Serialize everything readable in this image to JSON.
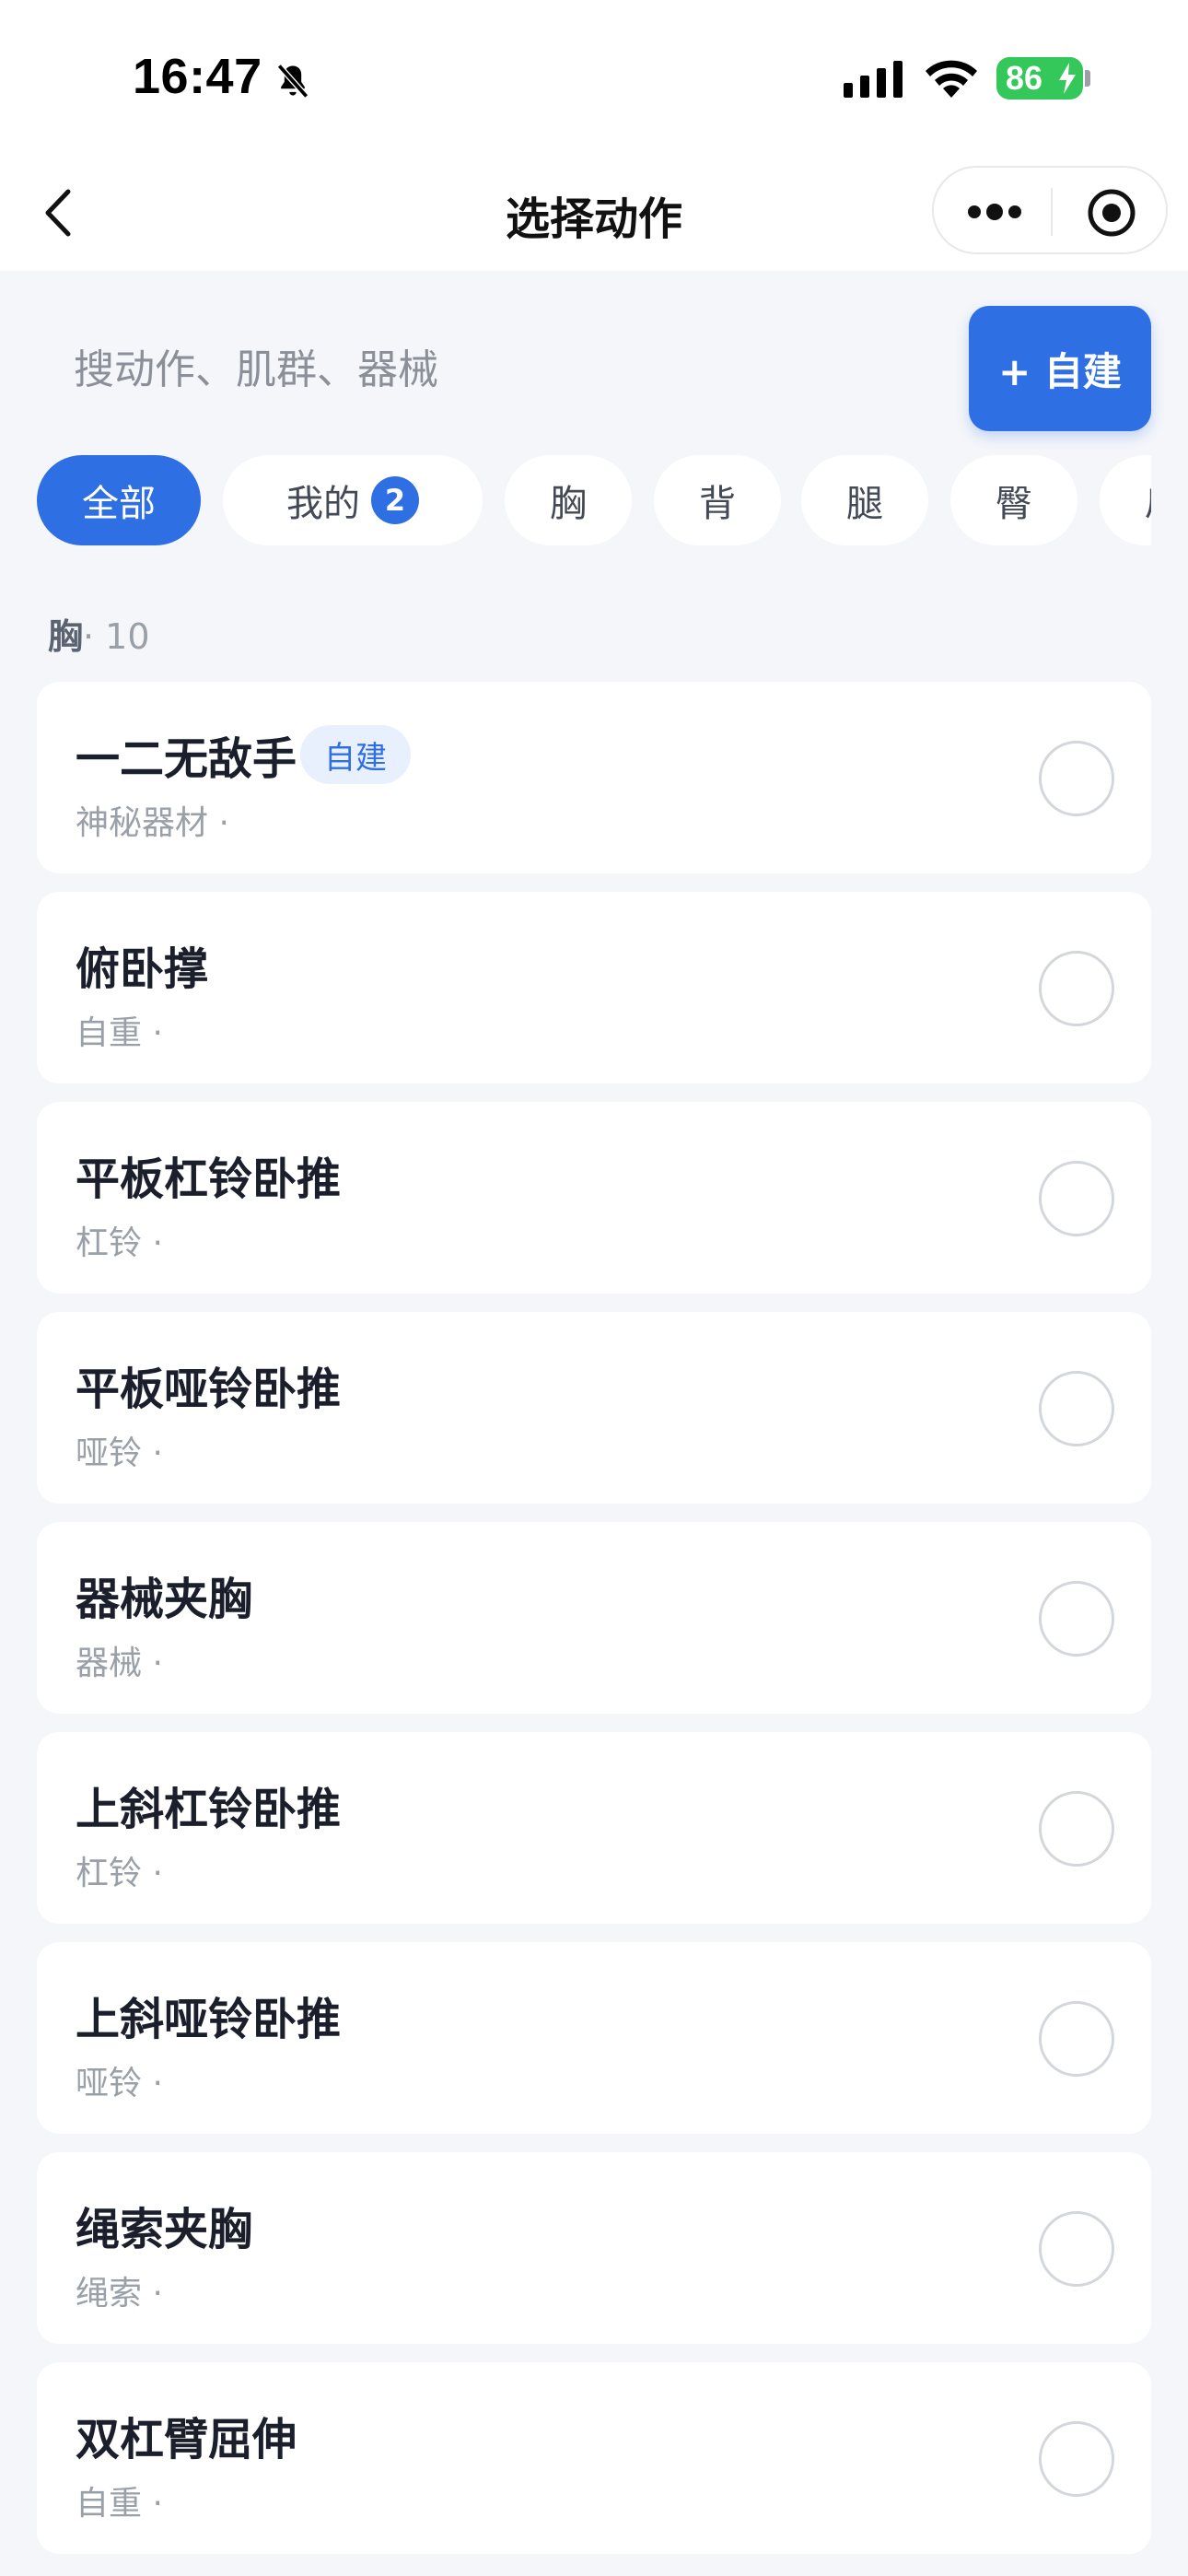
{
  "status_bar": {
    "time": "16:47",
    "battery": "86",
    "icons": [
      "bell-slash-icon",
      "cellular-signal-icon",
      "wifi-icon",
      "battery-charging-icon"
    ]
  },
  "nav": {
    "title": "选择动作",
    "icons": [
      "back-chevron-icon",
      "more-dots-icon",
      "target-icon"
    ]
  },
  "search": {
    "placeholder": "搜动作、肌群、器械",
    "create_label": "+ 自建"
  },
  "chips": [
    {
      "label": "全部",
      "active": true
    },
    {
      "label": "我的",
      "count": "2"
    },
    {
      "label": "胸"
    },
    {
      "label": "背"
    },
    {
      "label": "腿"
    },
    {
      "label": "臀"
    },
    {
      "label": "肩"
    }
  ],
  "section": {
    "name": "胸",
    "count": "· 10"
  },
  "exercises": [
    {
      "name": "一二无敌手",
      "tag": "自建",
      "equipment": "神秘器材 ·"
    },
    {
      "name": "俯卧撑",
      "equipment": "自重 ·"
    },
    {
      "name": "平板杠铃卧推",
      "equipment": "杠铃 ·"
    },
    {
      "name": "平板哑铃卧推",
      "equipment": "哑铃 ·"
    },
    {
      "name": "器械夹胸",
      "equipment": "器械 ·"
    },
    {
      "name": "上斜杠铃卧推",
      "equipment": "杠铃 ·"
    },
    {
      "name": "上斜哑铃卧推",
      "equipment": "哑铃 ·"
    },
    {
      "name": "绳索夹胸",
      "equipment": "绳索 ·"
    },
    {
      "name": "双杠臂屈伸",
      "equipment": "自重 ·"
    }
  ],
  "colors": {
    "accent": "#2f6fe4",
    "background": "#f4f6fa",
    "battery": "#34c759"
  }
}
